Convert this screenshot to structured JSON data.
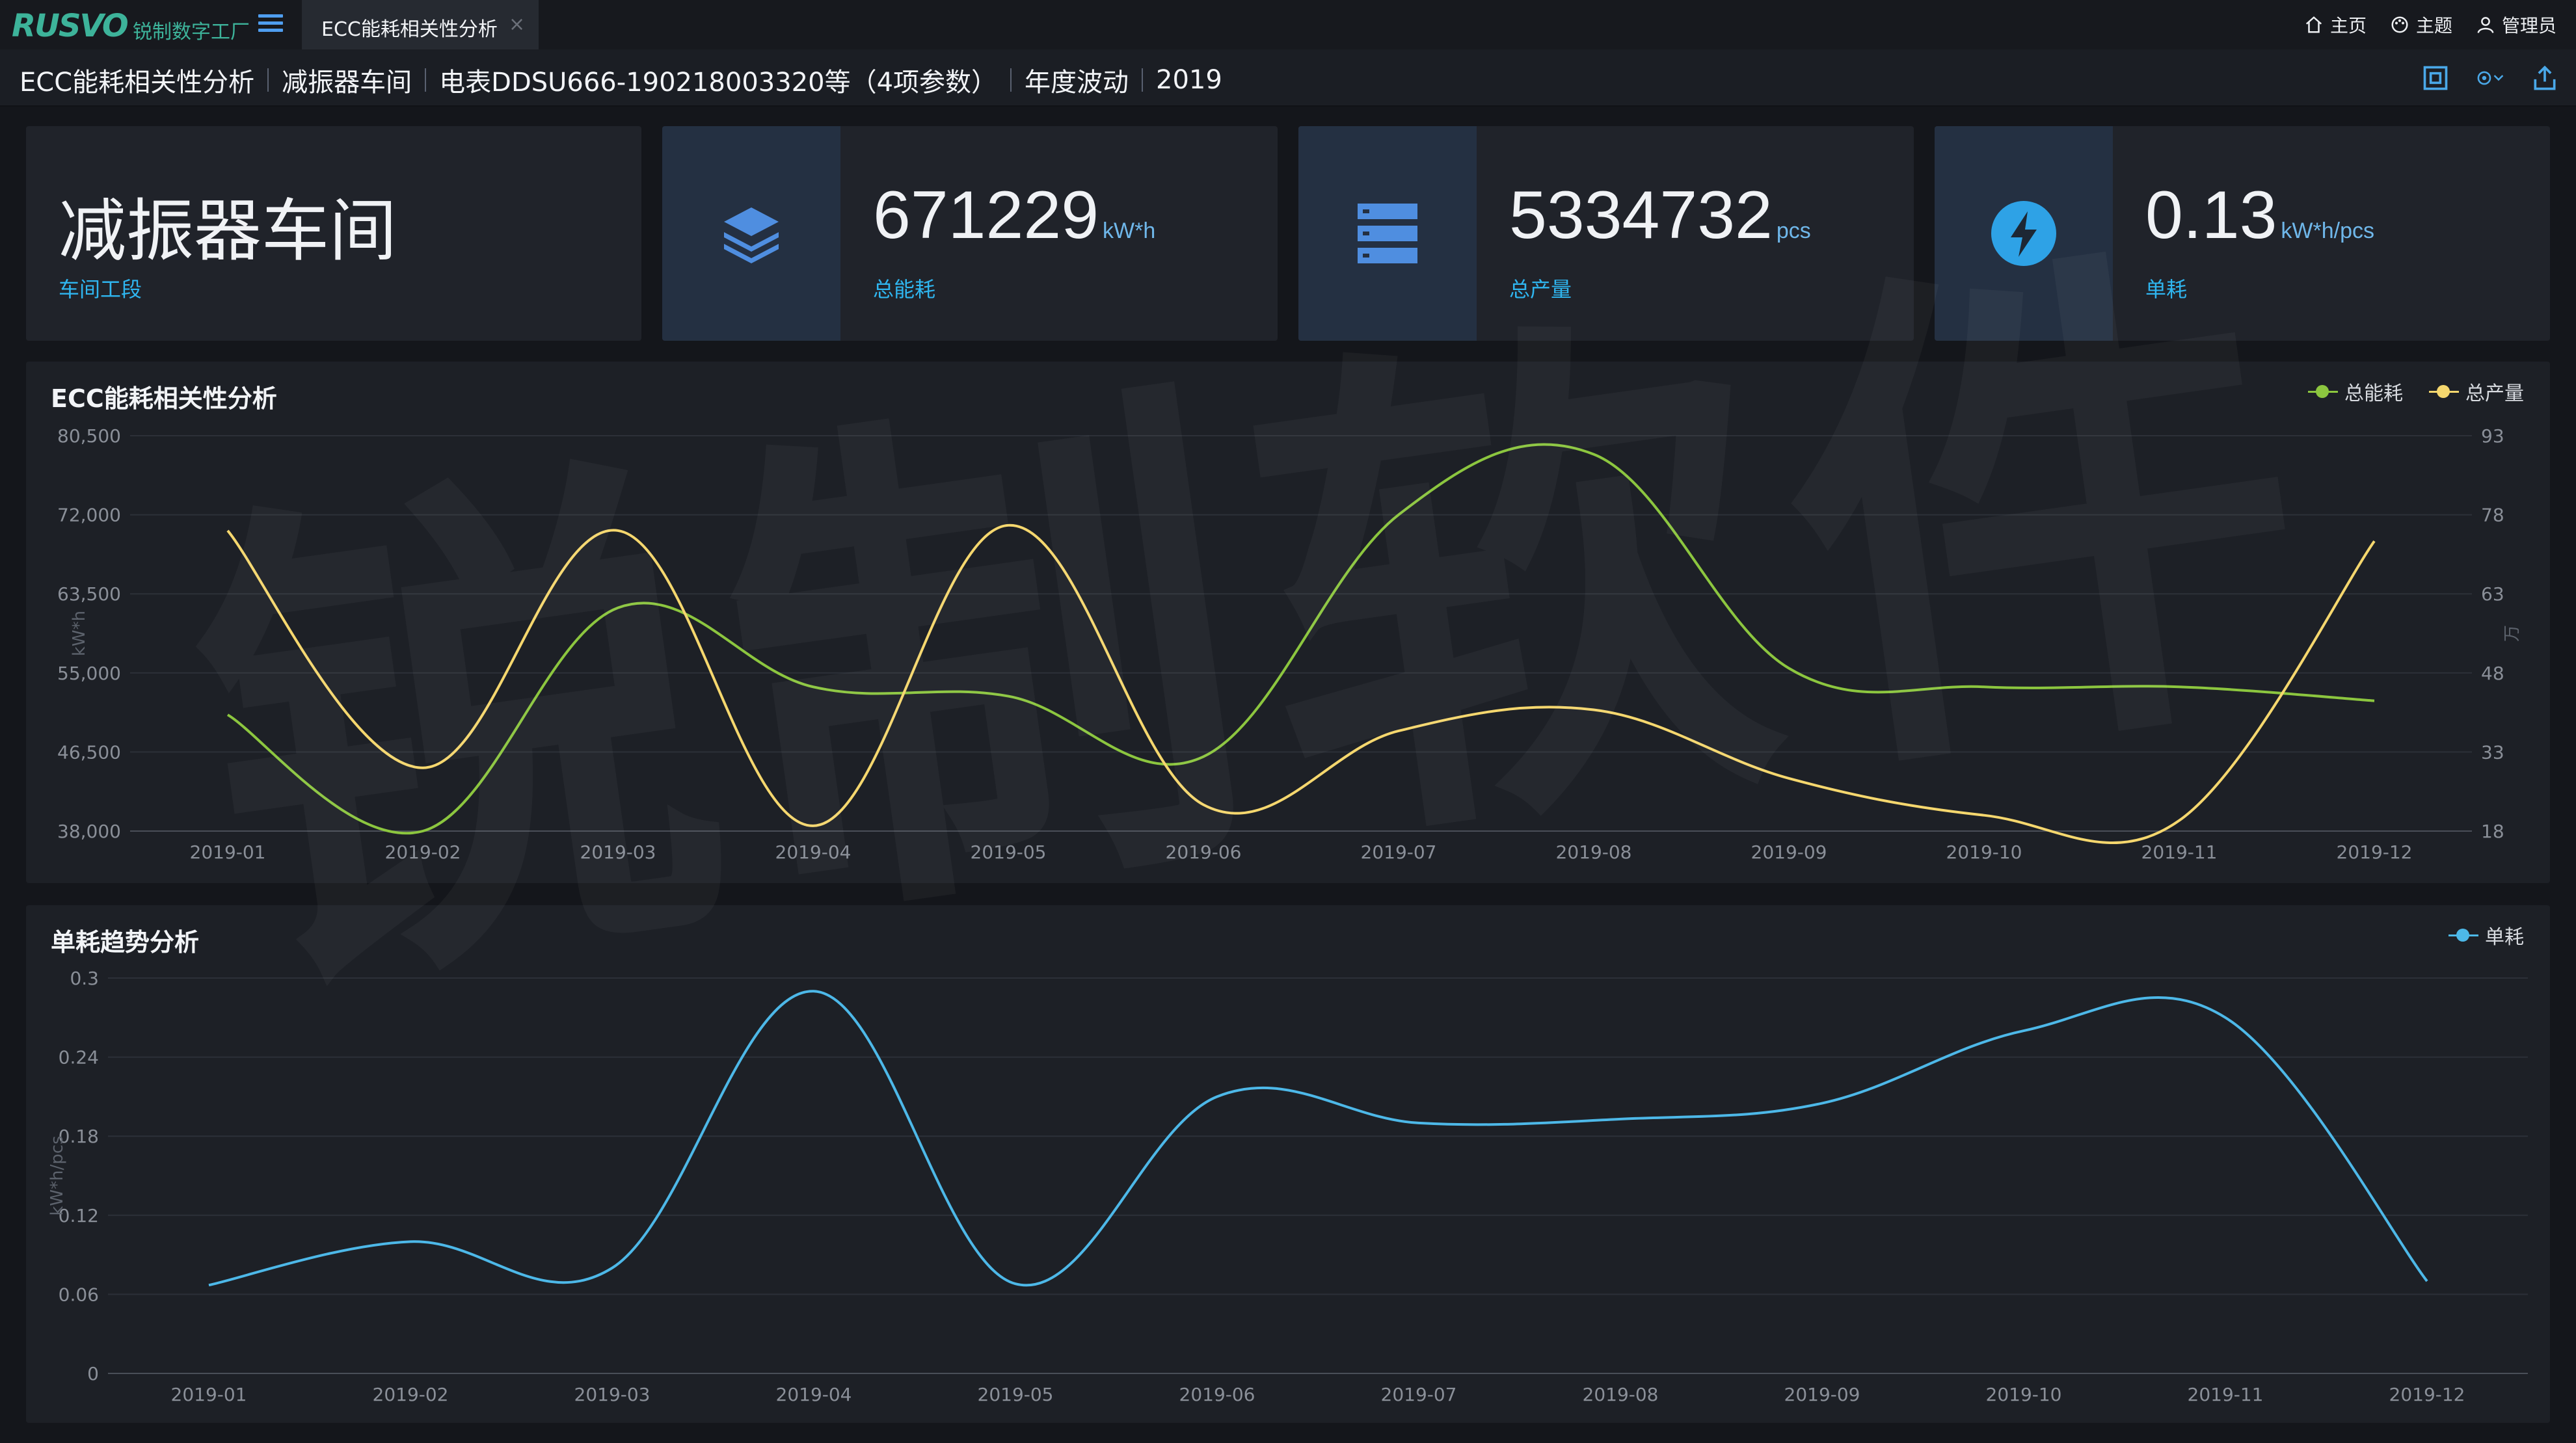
{
  "app": {
    "logo_text": "RUSVO",
    "logo_sub": "锐制数字工厂",
    "tab_label": "ECC能耗相关性分析",
    "tab_close": "×"
  },
  "topnav": [
    {
      "label": "主页",
      "icon": "home-icon"
    },
    {
      "label": "主题",
      "icon": "palette-icon"
    },
    {
      "label": "管理员",
      "icon": "user-icon"
    }
  ],
  "breadcrumb": {
    "items": [
      "ECC能耗相关性分析",
      "减振器车间",
      "电表DDSU666-190218003320等（4项参数）",
      "年度波动",
      "2019"
    ],
    "tools": [
      "screenshot-icon",
      "settings-icon",
      "export-icon"
    ]
  },
  "cards": {
    "workshop": {
      "title": "减振器车间",
      "caption": "车间工段"
    },
    "energy": {
      "value": "671229",
      "unit": "kW*h",
      "caption": "总能耗"
    },
    "output": {
      "value": "5334732",
      "unit": "pcs",
      "caption": "总产量"
    },
    "unit": {
      "value": "0.13",
      "unit": "kW*h/pcs",
      "caption": "单耗"
    }
  },
  "colors": {
    "energy": "#8cc63f",
    "output": "#f5d76e",
    "unit": "#4db8e8"
  },
  "watermark": "锐制软件",
  "chart_data": [
    {
      "type": "line",
      "title": "ECC能耗相关性分析",
      "categories": [
        "2019-01",
        "2019-02",
        "2019-03",
        "2019-04",
        "2019-05",
        "2019-06",
        "2019-07",
        "2019-08",
        "2019-09",
        "2019-10",
        "2019-11",
        "2019-12"
      ],
      "series": [
        {
          "name": "总能耗",
          "axis": "left",
          "color": "#8cc63f",
          "values": [
            50500,
            38000,
            62000,
            53500,
            52500,
            46000,
            72000,
            78500,
            55500,
            53500,
            53500,
            52000
          ]
        },
        {
          "name": "总产量",
          "axis": "right",
          "color": "#f5d76e",
          "values": [
            75,
            30,
            75,
            19,
            76,
            23,
            37,
            41,
            28,
            21,
            20,
            73
          ]
        }
      ],
      "ylabel_left": "kW*h",
      "ylabel_right": "万",
      "yticks_left": [
        "80,500",
        "72,000",
        "63,500",
        "55,000",
        "46,500",
        "38,000"
      ],
      "yticks_right": [
        "93",
        "78",
        "63",
        "48",
        "33",
        "18"
      ],
      "ylim_left": [
        38000,
        80500
      ],
      "ylim_right": [
        18,
        93
      ],
      "legend": "top-right",
      "grid": true
    },
    {
      "type": "line",
      "title": "单耗趋势分析",
      "categories": [
        "2019-01",
        "2019-02",
        "2019-03",
        "2019-04",
        "2019-05",
        "2019-06",
        "2019-07",
        "2019-08",
        "2019-09",
        "2019-10",
        "2019-11",
        "2019-12"
      ],
      "series": [
        {
          "name": "单耗",
          "color": "#4db8e8",
          "values": [
            0.067,
            0.1,
            0.08,
            0.29,
            0.068,
            0.21,
            0.19,
            0.193,
            0.205,
            0.26,
            0.27,
            0.07
          ]
        }
      ],
      "ylabel": "kW*h/pcs",
      "yticks": [
        "0.3",
        "0.24",
        "0.18",
        "0.12",
        "0.06",
        "0"
      ],
      "ylim": [
        0,
        0.3
      ],
      "legend": "top-right",
      "grid": true
    }
  ]
}
